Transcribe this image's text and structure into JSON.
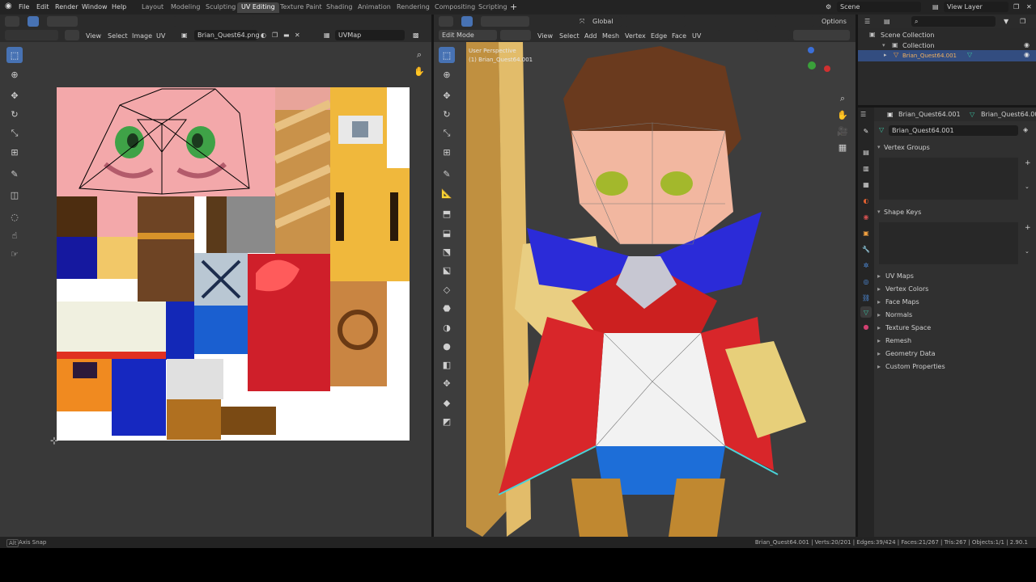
{
  "menu": {
    "file": "File",
    "edit": "Edit",
    "render": "Render",
    "window": "Window",
    "help": "Help"
  },
  "workspaces": [
    "Layout",
    "Modeling",
    "Sculpting",
    "UV Editing",
    "Texture Paint",
    "Shading",
    "Animation",
    "Rendering",
    "Compositing",
    "Scripting"
  ],
  "active_workspace": "UV Editing",
  "scene": "Scene",
  "view_layer": "View Layer",
  "uv_editor": {
    "menus": {
      "view": "View",
      "select": "Select",
      "image": "Image",
      "uv": "UV"
    },
    "image_name": "Brian_Quest64.png",
    "uv_map": "UVMap"
  },
  "viewport": {
    "mode": "Edit Mode",
    "menus": {
      "view": "View",
      "select": "Select",
      "add": "Add",
      "mesh": "Mesh",
      "vertex": "Vertex",
      "edge": "Edge",
      "face": "Face",
      "uv": "UV"
    },
    "orientation": "Global",
    "options": "Options",
    "overlay_line1": "User Perspective",
    "overlay_line2": "(1) Brian_Quest64.001"
  },
  "outliner": {
    "scene_collection": "Scene Collection",
    "collection": "Collection",
    "object": "Brian_Quest64.001"
  },
  "properties": {
    "breadcrumb_object": "Brian_Quest64.001",
    "breadcrumb_data": "Brian_Quest64.001",
    "mesh_name": "Brian_Quest64.001",
    "vertex_groups": "Vertex Groups",
    "shape_keys": "Shape Keys",
    "collapsed": [
      "UV Maps",
      "Vertex Colors",
      "Face Maps",
      "Normals",
      "Texture Space",
      "Remesh",
      "Geometry Data",
      "Custom Properties"
    ]
  },
  "status": {
    "left": "Axis Snap",
    "right": "Brian_Quest64.001 | Verts:20/201 | Edges:39/424 | Faces:21/267 | Tris:267 | Objects:1/1 | 2.90.1"
  },
  "colors": {
    "accent": "#4772b3",
    "panel": "#303030",
    "header": "#2b2b2b",
    "topbar": "#232323",
    "viewport_bg": "#3d3d3d",
    "uv_bg": "#393939"
  }
}
